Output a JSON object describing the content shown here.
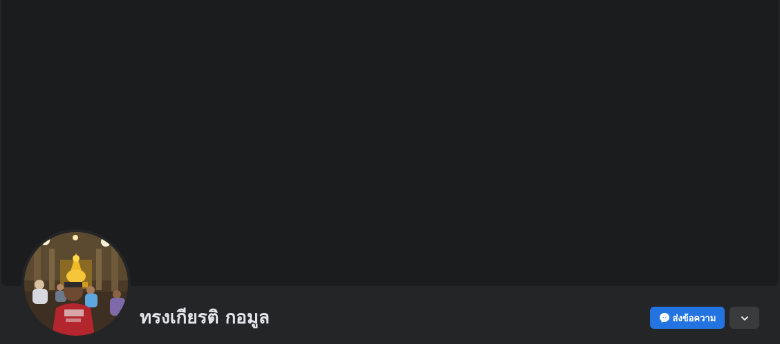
{
  "profile": {
    "name": "ทรงเกียรติ กอมูล"
  },
  "actions": {
    "message_label": "ส่งข้อความ",
    "message_icon": "messenger-icon",
    "more_icon": "chevron-down-icon"
  },
  "colors": {
    "page_background": "#242526",
    "cover_background": "#1b1c1e",
    "primary_button": "#2374e1",
    "secondary_button": "#3a3b3c",
    "name_text": "#e4e6eb"
  }
}
